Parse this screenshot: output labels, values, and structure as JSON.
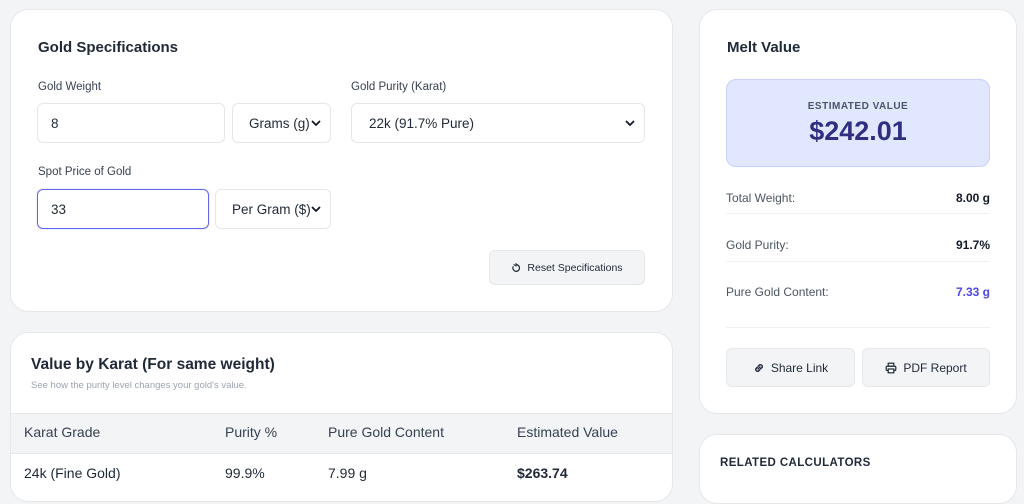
{
  "specs": {
    "title": "Gold Specifications",
    "weight_label": "Gold Weight",
    "weight_value": "8",
    "weight_unit": "Grams (g)",
    "purity_label": "Gold Purity (Karat)",
    "purity_value": "22k (91.7% Pure)",
    "spot_label": "Spot Price of Gold",
    "spot_value": "33",
    "spot_unit": "Per Gram ($)",
    "reset_label": "Reset Specifications"
  },
  "melt": {
    "title": "Melt Value",
    "estimated_label": "ESTIMATED VALUE",
    "estimated_value": "$242.01",
    "rows": [
      {
        "label": "Total Weight:",
        "value": "8.00 g"
      },
      {
        "label": "Gold Purity:",
        "value": "91.7%"
      },
      {
        "label": "Pure Gold Content:",
        "value": "7.33 g"
      }
    ],
    "share_label": "Share Link",
    "pdf_label": "PDF Report"
  },
  "karat": {
    "title": "Value by Karat (For same weight)",
    "subtitle": "See how the purity level changes your gold's value.",
    "headers": [
      "Karat Grade",
      "Purity %",
      "Pure Gold Content",
      "Estimated Value"
    ],
    "rows": [
      {
        "grade": "24k (Fine Gold)",
        "purity": "99.9%",
        "content": "7.99 g",
        "value": "$263.74"
      }
    ]
  },
  "related": {
    "title": "RELATED CALCULATORS"
  },
  "colors": {
    "accent": "#6366f1",
    "estimated_bg": "#e0e7ff",
    "estimated_text": "#312e81",
    "highlight_value": "#4f46e5"
  }
}
